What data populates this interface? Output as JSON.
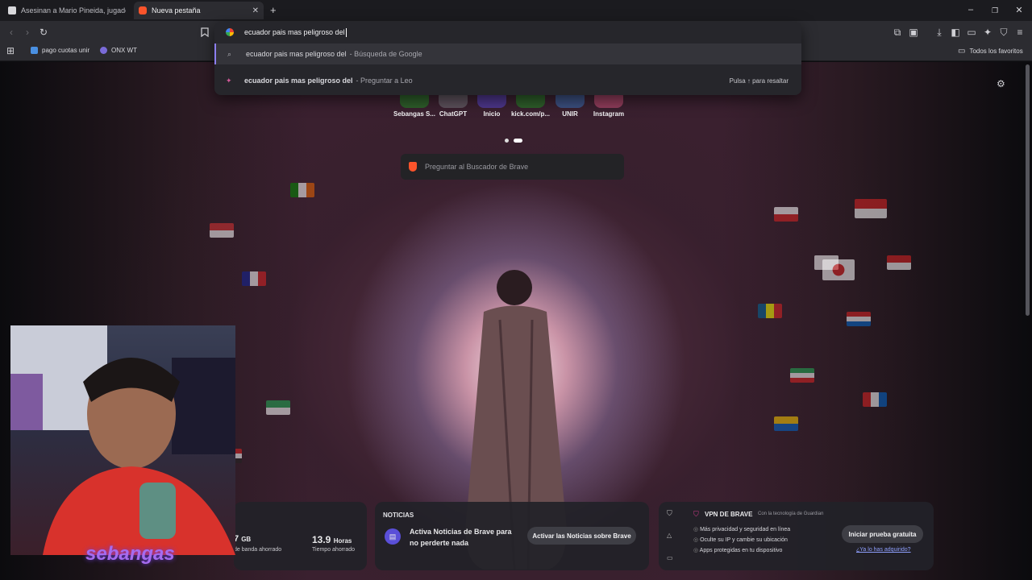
{
  "tabs": [
    {
      "label": "Asesinan a Mario Pineida, jugador de",
      "active": false
    },
    {
      "label": "Nueva pestaña",
      "active": true
    }
  ],
  "toolbar": {
    "new_tab_symbol": "+"
  },
  "omnibox": {
    "query": "ecuador pais mas peligroso del",
    "suggestions": [
      {
        "text": "ecuador pais mas peligroso del",
        "sub": "- Búsqueda de Google"
      },
      {
        "text": "ecuador pais mas peligroso del",
        "sub": "- Preguntar a Leo",
        "hint": "Pulsa ↑ para resaltar"
      }
    ]
  },
  "bookmarks": {
    "items": [
      "pago cuotas unir",
      "ONX WT"
    ],
    "all": "Todos los favoritos"
  },
  "top_sites": [
    "Sebangas S...",
    "ChatGPT",
    "Inicio",
    "kick.com/p...",
    "UNIR",
    "Instagram"
  ],
  "search": {
    "placeholder": "Preguntar al Buscador de Brave"
  },
  "stats": {
    "gb_value": "7",
    "gb_unit": "GB",
    "gb_label": "de banda ahorrado",
    "hours_value": "13.9",
    "hours_unit": "Horas",
    "hours_label": "Tiempo ahorrado"
  },
  "news": {
    "heading": "NOTICIAS",
    "text": "Activa Noticias de Brave para no perderte nada",
    "button": "Activar las Noticias sobre Brave"
  },
  "vpn": {
    "heading": "VPN DE BRAVE",
    "powered": "Con la tecnología de",
    "partner": "Guardian",
    "features": [
      "Más privacidad y seguridad en línea",
      "Oculte su IP y cambie su ubicación",
      "Apps protegidas en tu dispositivo"
    ],
    "button": "Iniciar prueba gratuita",
    "link": "¿Ya lo has adquirido?"
  },
  "overlay": {
    "watermark": "sebangas"
  },
  "colors": {
    "accent": "#8c7ef0",
    "brave": "#fb542b",
    "vpn": "#d23a8a"
  }
}
